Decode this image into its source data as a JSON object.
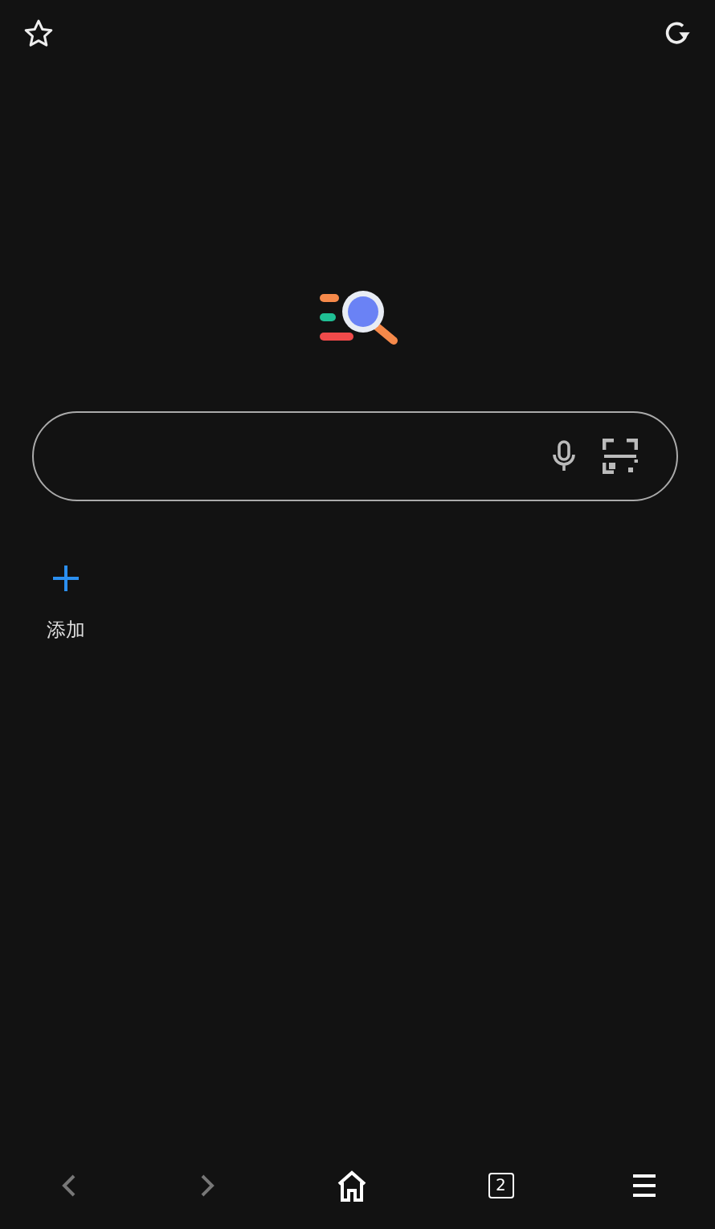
{
  "shortcuts": [
    {
      "label": "添加"
    }
  ],
  "bottom_nav": {
    "back": {
      "disabled": true
    },
    "forward": {
      "disabled": true
    },
    "tab_count": "2"
  }
}
